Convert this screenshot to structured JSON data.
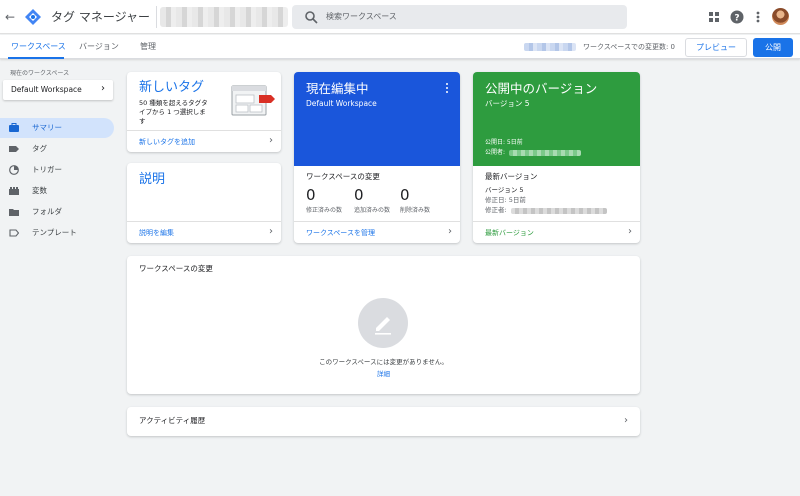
{
  "header": {
    "back_icon": "arrow-left-icon",
    "app_title": "タグ マネージャー",
    "search_placeholder": "検索ワークスペース",
    "brand_color": "#1a73e8"
  },
  "tabs": [
    {
      "label": "ワークスペース"
    },
    {
      "label": "バージョン"
    },
    {
      "label": "管理"
    }
  ],
  "toolbar": {
    "workspace_changes_label": "ワークスペースでの変更数: 0",
    "preview_label": "プレビュー",
    "publish_label": "公開"
  },
  "sidebar": {
    "current_workspace_label": "現在のワークスペース",
    "workspace_name": "Default Workspace",
    "items": [
      {
        "label": "サマリー",
        "icon": "briefcase-icon"
      },
      {
        "label": "タグ",
        "icon": "tag-icon"
      },
      {
        "label": "トリガー",
        "icon": "trigger-icon"
      },
      {
        "label": "変数",
        "icon": "variable-icon"
      },
      {
        "label": "フォルダ",
        "icon": "folder-icon"
      },
      {
        "label": "テンプレート",
        "icon": "template-icon"
      }
    ]
  },
  "cards": {
    "new_tag": {
      "title": "新しいタグ",
      "desc_line1": "50 種類を超えるタグタ",
      "desc_line2": "イプから 1 つ選択しま",
      "desc_line3": "す",
      "link": "新しいタグを追加"
    },
    "description": {
      "title": "説明",
      "link": "説明を編集"
    },
    "editing": {
      "title": "現在編集中",
      "subtitle": "Default Workspace",
      "changes_title": "ワークスペースの変更",
      "stats": [
        {
          "value": "0",
          "label": "修正済みの数"
        },
        {
          "value": "0",
          "label": "追加済みの数"
        },
        {
          "value": "0",
          "label": "削除済み数"
        }
      ],
      "link": "ワークスペースを管理",
      "color": "#1a56db"
    },
    "published": {
      "title": "公開中のバージョン",
      "subtitle": "バージョン 5",
      "published_date": "公開日: 5日前",
      "published_by": "公開者:",
      "latest_title": "最新バージョン",
      "latest_version": "バージョン 5",
      "modified_date": "修正日: 5日前",
      "modified_by": "修正者:",
      "link": "最新バージョン",
      "color": "#2e9c3f"
    },
    "workspace_changes": {
      "title": "ワークスペースの変更",
      "empty_text": "このワークスペースには変更がありません。",
      "details_link": "詳細"
    },
    "activity": {
      "title": "アクティビティ履歴"
    }
  }
}
